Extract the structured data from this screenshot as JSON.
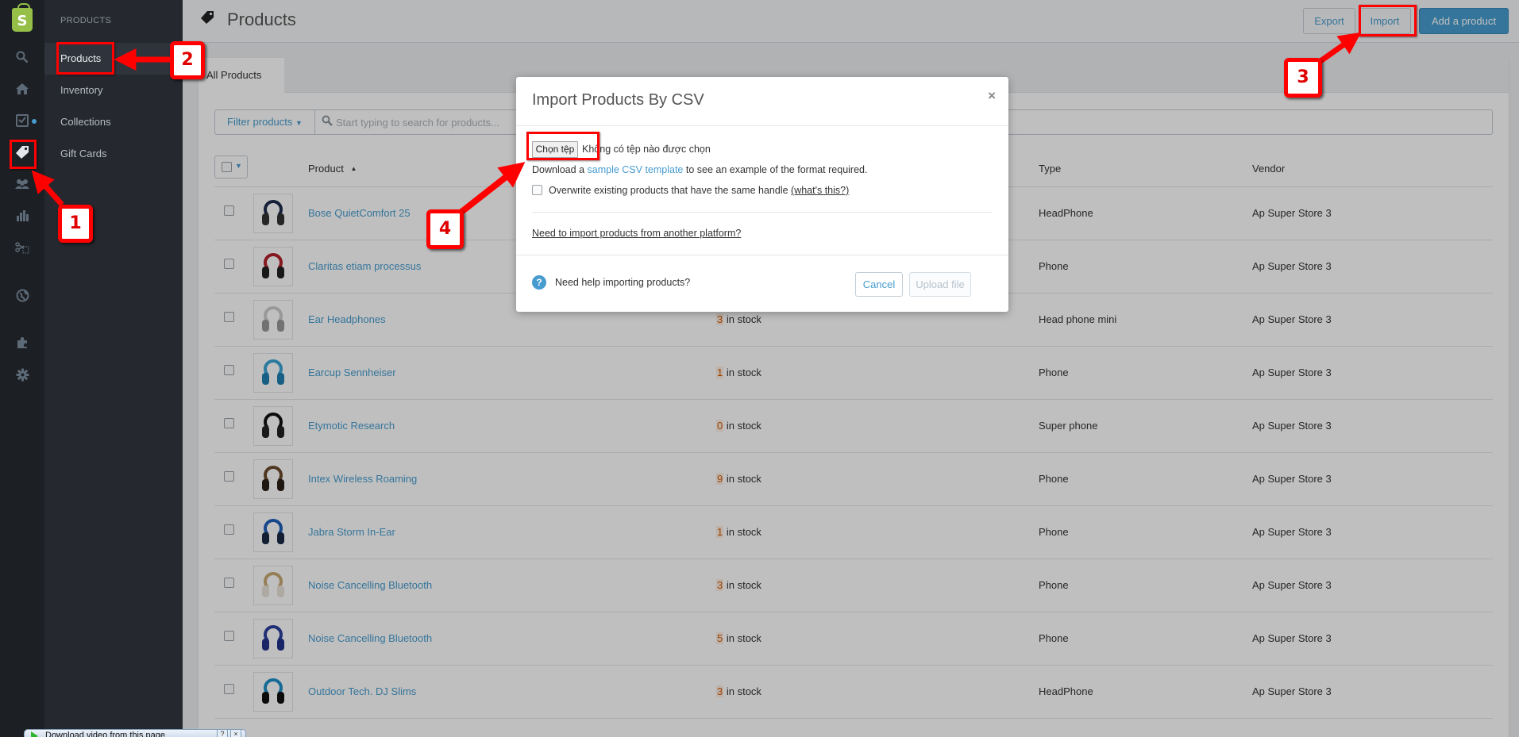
{
  "rail": {
    "items": [
      "shopify-logo",
      "search",
      "home",
      "orders",
      "products",
      "customers",
      "reports",
      "discounts",
      "online-store",
      "apps",
      "settings"
    ],
    "logo_letter": "S"
  },
  "subnav": {
    "section_title": "PRODUCTS",
    "items": [
      {
        "label": "Products",
        "selected": true
      },
      {
        "label": "Inventory",
        "selected": false
      },
      {
        "label": "Collections",
        "selected": false
      },
      {
        "label": "Gift Cards",
        "selected": false
      }
    ]
  },
  "header": {
    "title": "Products",
    "export_label": "Export",
    "import_label": "Import",
    "add_label": "Add a product"
  },
  "tabs": [
    {
      "label": "All Products"
    }
  ],
  "filter": {
    "button_label": "Filter products",
    "search_placeholder": "Start typing to search for products...",
    "search_value": ""
  },
  "table": {
    "columns": {
      "product": "Product",
      "inventory": "",
      "type": "Type",
      "vendor": "Vendor"
    },
    "sort_indicator": "▲",
    "rows": [
      {
        "name": "Bose QuietComfort 25",
        "stock": "",
        "stock_suffix": "",
        "type": "HeadPhone",
        "vendor": "Ap Super Store 3",
        "colors": [
          "#1f2b4d",
          "#333"
        ]
      },
      {
        "name": "Claritas etiam processus",
        "stock": "",
        "stock_suffix": "",
        "type": "Phone",
        "vendor": "Ap Super Store 3",
        "colors": [
          "#b3202a",
          "#222"
        ]
      },
      {
        "name": "Ear Headphones",
        "stock": "3",
        "stock_suffix": " in stock",
        "type": "Head phone mini",
        "vendor": "Ap Super Store 3",
        "colors": [
          "#ccc",
          "#999"
        ]
      },
      {
        "name": "Earcup Sennheiser",
        "stock": "1",
        "stock_suffix": " in stock",
        "type": "Phone",
        "vendor": "Ap Super Store 3",
        "colors": [
          "#3aa3d4",
          "#1f7fb0"
        ]
      },
      {
        "name": "Etymotic Research",
        "stock": "0",
        "stock_suffix": " in stock",
        "type": "Super phone",
        "vendor": "Ap Super Store 3",
        "colors": [
          "#111",
          "#222"
        ]
      },
      {
        "name": "Intex Wireless Roaming",
        "stock": "9",
        "stock_suffix": " in stock",
        "type": "Phone",
        "vendor": "Ap Super Store 3",
        "colors": [
          "#6b4a2c",
          "#2a1f18"
        ]
      },
      {
        "name": "Jabra Storm In-Ear",
        "stock": "1",
        "stock_suffix": " in stock",
        "type": "Phone",
        "vendor": "Ap Super Store 3",
        "colors": [
          "#1e5fb8",
          "#1a2a44"
        ]
      },
      {
        "name": "Noise Cancelling Bluetooth",
        "stock": "3",
        "stock_suffix": " in stock",
        "type": "Phone",
        "vendor": "Ap Super Store 3",
        "colors": [
          "#c9a873",
          "#e8e2d8"
        ]
      },
      {
        "name": "Noise Cancelling Bluetooth",
        "stock": "5",
        "stock_suffix": " in stock",
        "type": "Phone",
        "vendor": "Ap Super Store 3",
        "colors": [
          "#2c3f9e",
          "#223288"
        ]
      },
      {
        "name": "Outdoor Tech. DJ Slims",
        "stock": "3",
        "stock_suffix": " in stock",
        "type": "HeadPhone",
        "vendor": "Ap Super Store 3",
        "colors": [
          "#1d8fc9",
          "#111"
        ]
      }
    ]
  },
  "modal": {
    "title": "Import Products By CSV",
    "close_glyph": "×",
    "file_button": "Chọn tệp",
    "file_status": "Không có tệp nào được chọn",
    "download_prefix": "Download a ",
    "download_link": "sample CSV template",
    "download_suffix": " to see an example of the format required.",
    "overwrite_label": "Overwrite existing products that have the same handle ",
    "whats_this": "(what's this?)",
    "overwrite_checked": false,
    "platform_link": "Need to import products from another platform?",
    "help_text": "Need help importing products?",
    "cancel_label": "Cancel",
    "upload_label": "Upload file"
  },
  "annotations": [
    {
      "number": "1",
      "target": "products-rail-icon"
    },
    {
      "number": "2",
      "target": "subnav-products"
    },
    {
      "number": "3",
      "target": "import-button"
    },
    {
      "number": "4",
      "target": "choose-file-button"
    }
  ],
  "plugin_bar": {
    "text": "Download video from this page",
    "help_glyph": "?",
    "close_glyph": "×"
  },
  "colors": {
    "accent": "#479ccf",
    "annotation": "#ff0000",
    "stock_number": "#d35400",
    "shopify_green": "#95bf47"
  }
}
